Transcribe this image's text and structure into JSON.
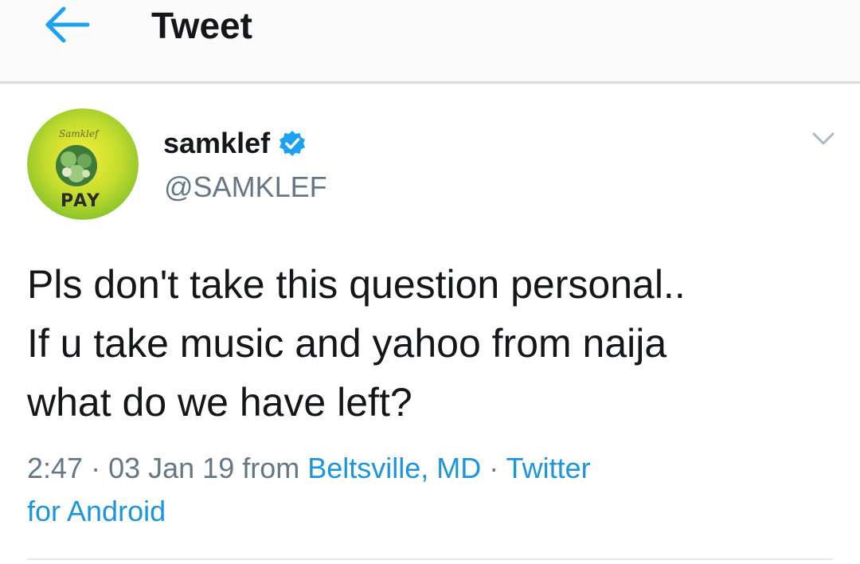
{
  "header": {
    "title": "Tweet",
    "back_icon": "arrow-left-icon",
    "accent_color": "#1da1f2"
  },
  "tweet": {
    "author": {
      "display_name": "samklef",
      "handle": "@SAMKLEF",
      "verified": true,
      "avatar_logo_text": "PAY"
    },
    "text_lines": [
      "Pls don't take this question personal..",
      "If u take music and yahoo from naija",
      "what do we have left?"
    ],
    "meta": {
      "time": "2:47",
      "sep1": " · ",
      "date": "03 Jan 19",
      "from_word": " from ",
      "location": "Beltsville, MD",
      "sep2": " · ",
      "source_line1": "Twitter",
      "source_line2": "for Android"
    },
    "link_color": "#1b95e0"
  }
}
